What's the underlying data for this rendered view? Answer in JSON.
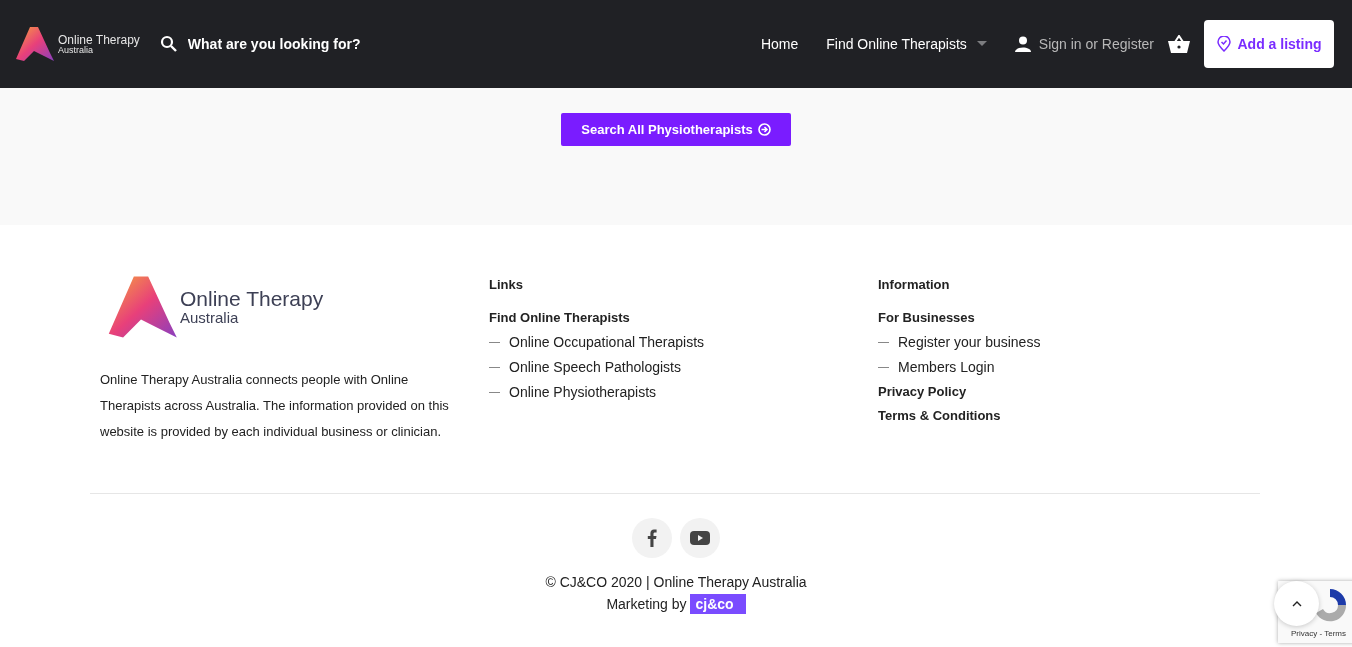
{
  "header": {
    "logo": {
      "name": "Online Therapy",
      "sub": "Australia"
    },
    "search": {
      "placeholder": "What are you looking for?"
    },
    "nav": [
      {
        "label": "Home",
        "dropdown": false
      },
      {
        "label": "Find Online Therapists",
        "dropdown": true
      }
    ],
    "account": "Sign in or Register",
    "add_listing": "Add a listing"
  },
  "hero": {
    "button": "Search All Physiotherapists"
  },
  "footer": {
    "logo": {
      "name": "Online Therapy",
      "sub": "Australia"
    },
    "about": "Online Therapy Australia connects people with Online Therapists across Australia. The information provided on this website is provided by each individual business or clinician.",
    "columns": [
      {
        "title": "Links",
        "items": [
          {
            "kind": "heading",
            "label": "Find Online Therapists"
          },
          {
            "kind": "sub",
            "label": "Online Occupational Therapists"
          },
          {
            "kind": "sub",
            "label": "Online Speech Pathologists"
          },
          {
            "kind": "sub",
            "label": "Online Physiotherapists"
          }
        ]
      },
      {
        "title": "Information",
        "items": [
          {
            "kind": "heading",
            "label": "For Businesses"
          },
          {
            "kind": "sub",
            "label": "Register your business"
          },
          {
            "kind": "sub",
            "label": "Members Login"
          },
          {
            "kind": "heading",
            "label": "Privacy Policy"
          },
          {
            "kind": "heading",
            "label": "Terms & Conditions"
          }
        ]
      }
    ],
    "social": [
      {
        "kind": "facebook"
      },
      {
        "kind": "youtube"
      }
    ],
    "copyright": "© CJ&CO 2020 | Online Therapy Australia",
    "marketing": "Marketing by",
    "marketing_brand": "cj&co"
  },
  "recaptcha": {
    "links": "Privacy - Terms"
  }
}
